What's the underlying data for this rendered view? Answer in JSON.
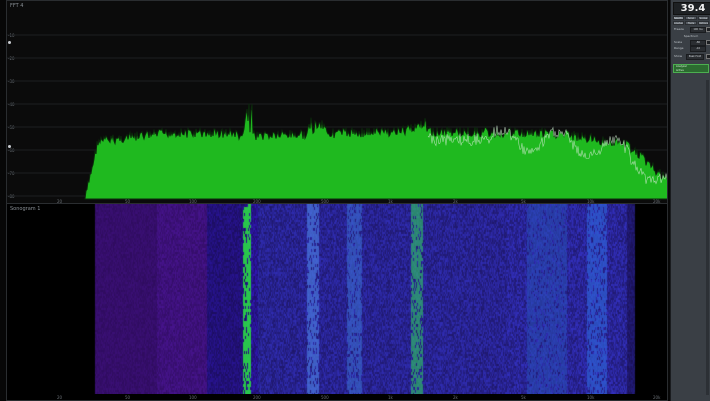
{
  "app": {
    "sample_rate_display": "39.4"
  },
  "spectrum": {
    "title": "FFT 4",
    "y_ticks": [
      "-10",
      "-20",
      "-30",
      "-40",
      "-50",
      "-60",
      "-70",
      "-80"
    ],
    "x_ticks": [
      "20",
      "50",
      "100",
      "200",
      "500",
      "1k",
      "2k",
      "5k",
      "10k",
      "20k"
    ],
    "colors": {
      "fill": "#1fb91f",
      "peak": "#cfe9cf",
      "outline": "#0b2b0b"
    }
  },
  "sonogram": {
    "title": "Sonogram 1",
    "x_ticks": [
      "20",
      "50",
      "100",
      "200",
      "500",
      "1k",
      "2k",
      "5k",
      "10k",
      "20k"
    ],
    "colors": {
      "low": "#1a0b4a",
      "mid": "#1f4fbf",
      "high": "#2ad04a"
    }
  },
  "sidebar": {
    "tabs_row1": [
      "Spectrum",
      "Sono",
      "Scope"
    ],
    "tabs_row2": [
      "Analysis",
      "Tools",
      "Options"
    ],
    "preset_label": "Freeze",
    "preset_value": "100 ms",
    "section_title": "Spectrum",
    "fields": [
      {
        "label": "Scale",
        "value": "-80"
      },
      {
        "label": "Range",
        "value": "-10"
      }
    ],
    "option_label": "Show",
    "option_value": "Peak Hold",
    "panel_title": "Analyzer",
    "panel_sub": "Active"
  }
}
